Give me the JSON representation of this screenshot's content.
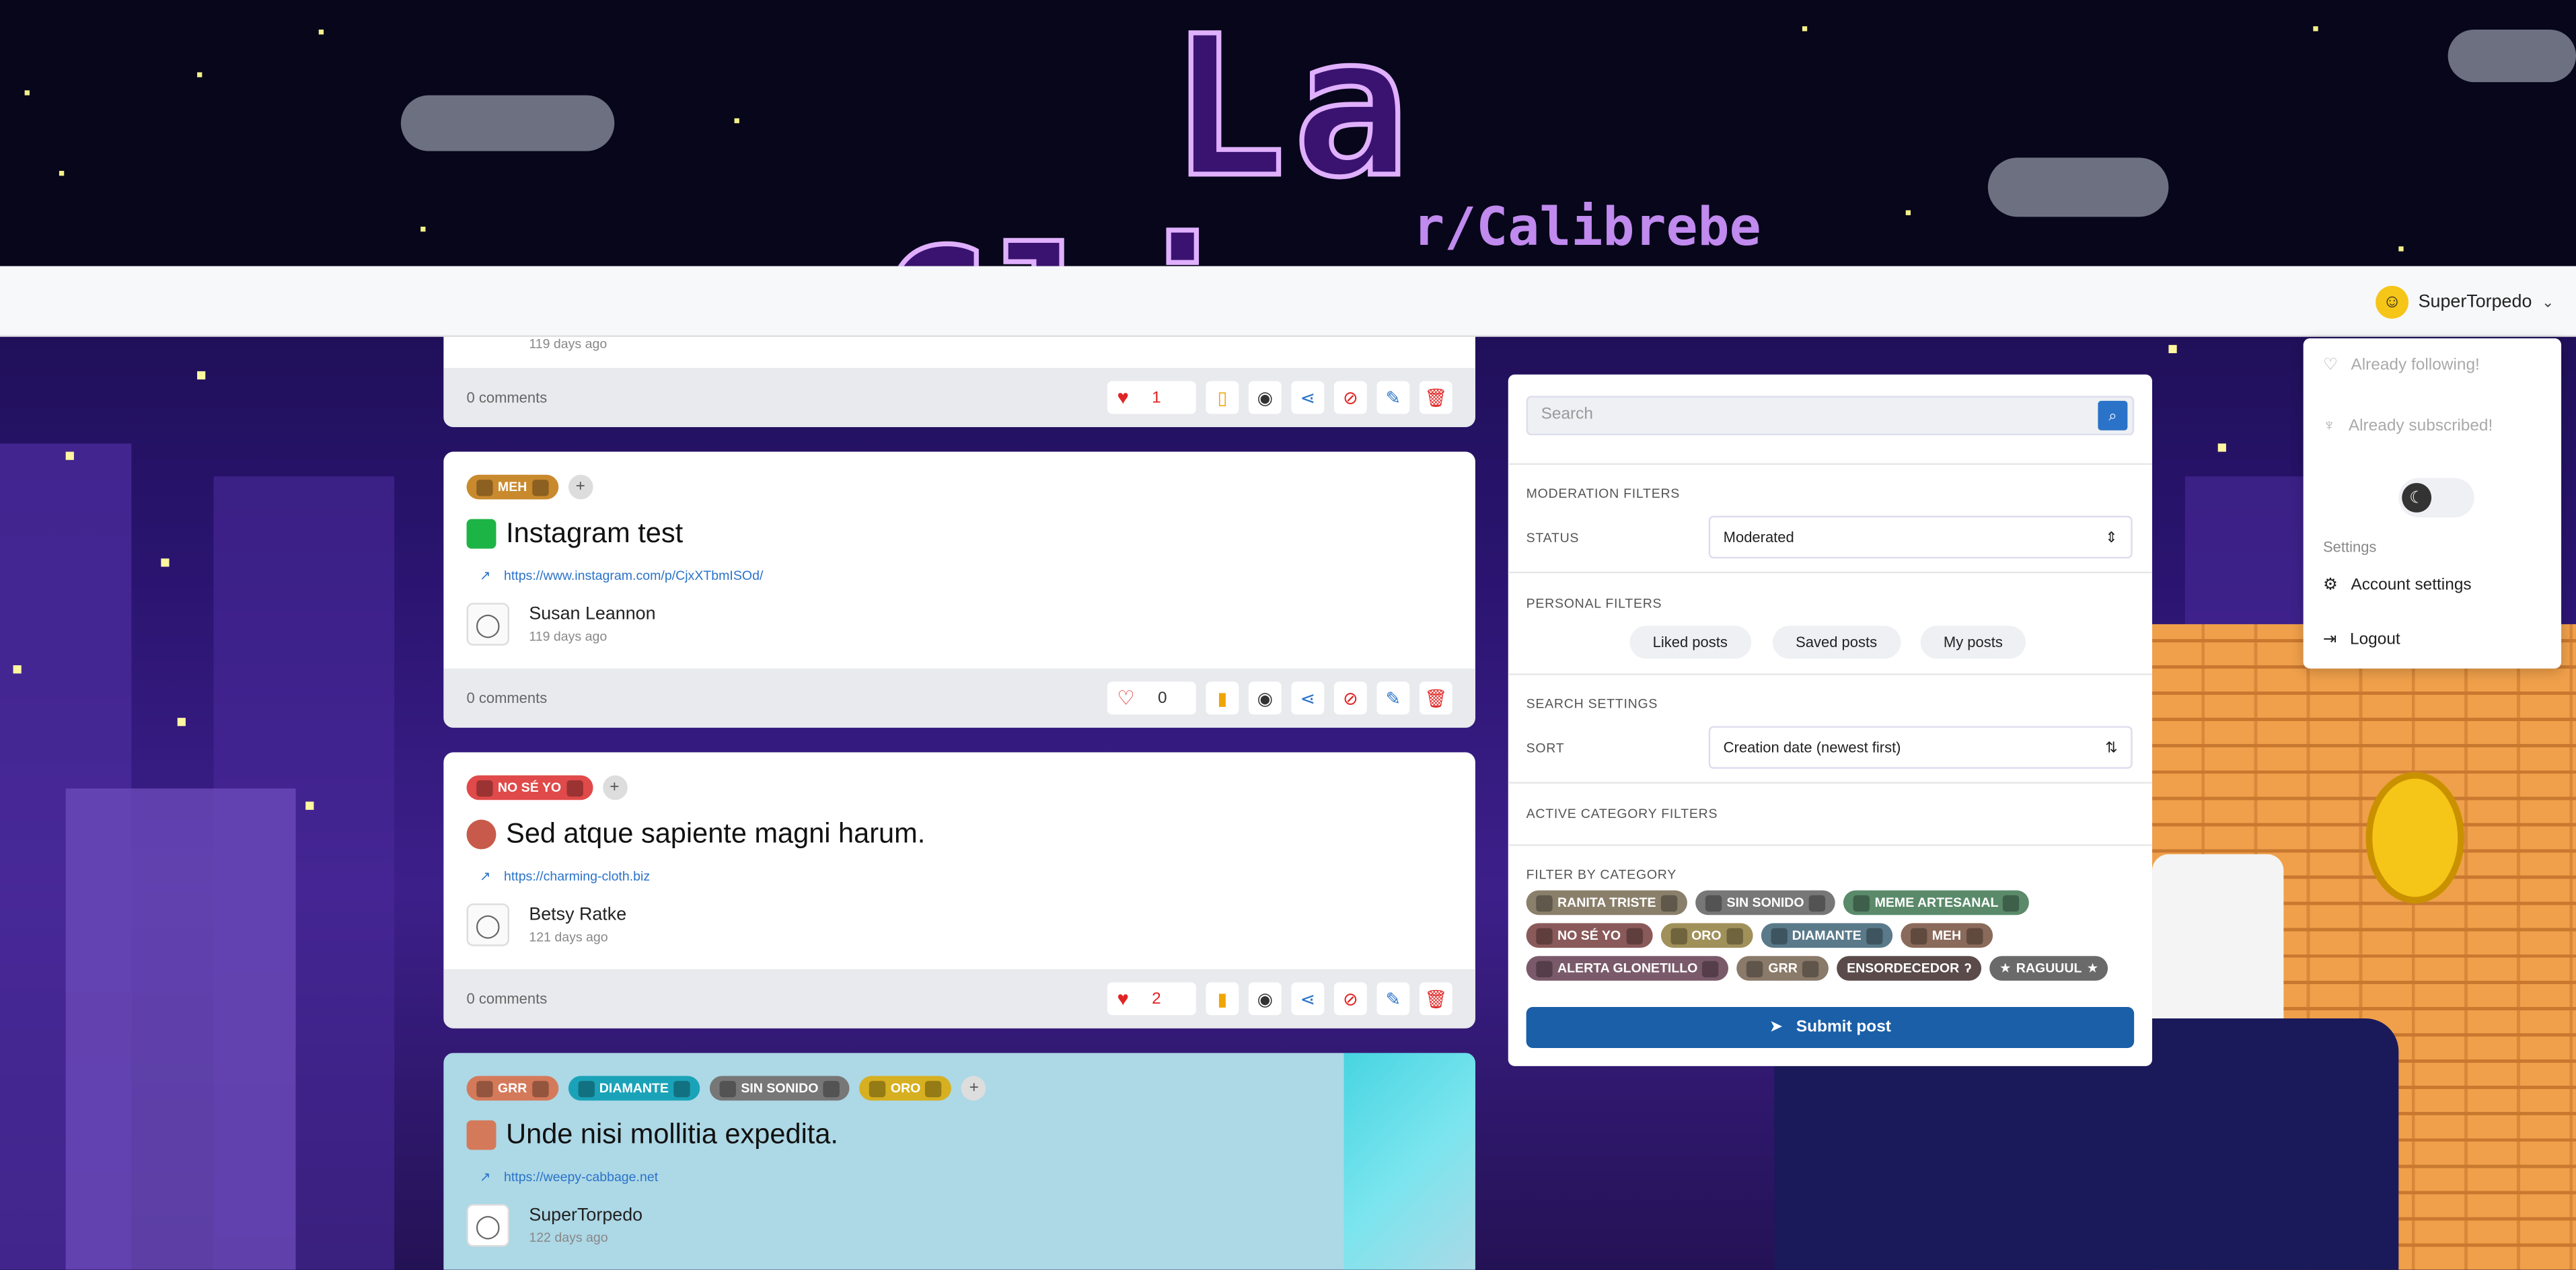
{
  "banner": {
    "title": "La Clipasa",
    "subtitle": "r/Calibrebe"
  },
  "navbar": {
    "username": "SuperTorpedo"
  },
  "dropdown": {
    "already_following": "Already following!",
    "already_subscribed": "Already subscribed!",
    "settings_label": "Settings",
    "account_settings": "Account settings",
    "logout": "Logout"
  },
  "posts": [
    {
      "date": "119 days ago",
      "comments": "0 comments",
      "likes": "1"
    },
    {
      "tags": [
        "MEH"
      ],
      "title": "Instagram test",
      "link": "https://www.instagram.com/p/CjxXTbmISOd/",
      "author": "Susan Leannon",
      "date": "119 days ago",
      "comments": "0 comments",
      "likes": "0"
    },
    {
      "tags": [
        "NO SÉ YO"
      ],
      "title": "Sed atque sapiente magni harum.",
      "link": "https://charming-cloth.biz",
      "author": "Betsy Ratke",
      "date": "121 days ago",
      "comments": "0 comments",
      "likes": "2"
    },
    {
      "tags": [
        "GRR",
        "DIAMANTE",
        "SIN SONIDO",
        "ORO"
      ],
      "title": "Unde nisi mollitia expedita.",
      "link": "https://weepy-cabbage.net",
      "author": "SuperTorpedo",
      "date": "122 days ago"
    }
  ],
  "sidebar": {
    "search_placeholder": "Search",
    "moderation_filters": "MODERATION FILTERS",
    "status_label": "STATUS",
    "status_value": "Moderated",
    "personal_filters": "PERSONAL FILTERS",
    "personal": [
      "Liked posts",
      "Saved posts",
      "My posts"
    ],
    "search_settings": "SEARCH SETTINGS",
    "sort_label": "SORT",
    "sort_value": "Creation date (newest first)",
    "active_category_filters": "ACTIVE CATEGORY FILTERS",
    "filter_by_category": "FILTER BY CATEGORY",
    "categories_row1": [
      "RANITA TRISTE",
      "SIN SONIDO",
      "MEME ARTESANAL"
    ],
    "categories_row2": [
      "NO SÉ YO",
      "ORO",
      "DIAMANTE",
      "MEH"
    ],
    "categories_row3": [
      "ALERTA GLONETILLO",
      "GRR",
      "ENSORDECEDOR",
      "RAGUUUL"
    ],
    "submit_label": "Submit post"
  },
  "colors": {
    "badge_meh": "#c98a2e",
    "badge_nose": "#e04a4a",
    "badge_grr": "#d47a5a",
    "badge_diamante": "#1aa3b8",
    "badge_sinsonido": "#777777",
    "badge_oro": "#d6b020",
    "submit_bg": "#1a5fa8"
  }
}
